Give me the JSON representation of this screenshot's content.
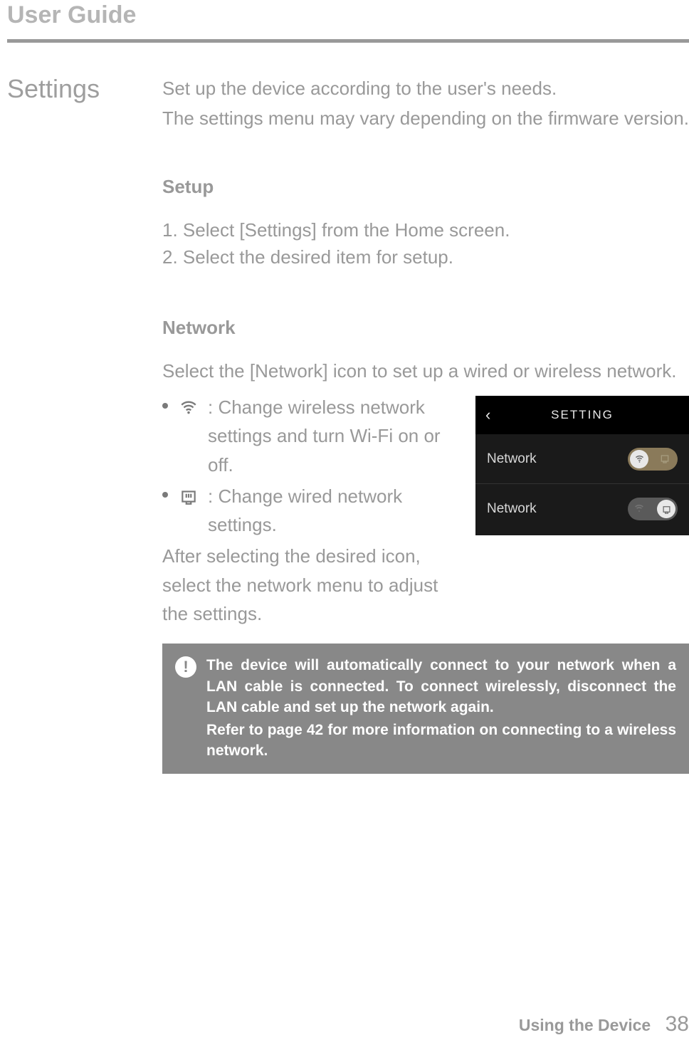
{
  "header": {
    "title": "User Guide"
  },
  "section": {
    "heading": "Settings",
    "intro1": "Set up the device according to the user's needs.",
    "intro2": "The settings menu may vary depending on the firmware version."
  },
  "setup": {
    "heading": "Setup",
    "step1": "1. Select [Settings] from the Home screen.",
    "step2": "2. Select the desired item for setup."
  },
  "network": {
    "heading": "Network",
    "intro": "Select the [Network] icon to set up a wired or wireless network.",
    "bullet1": ": Change wireless network settings and turn Wi-Fi on or off.",
    "bullet2": ": Change wired network settings.",
    "after": "After selecting the desired icon, select the network menu to adjust the settings."
  },
  "screenshot": {
    "title": "SETTING",
    "row1_label": "Network",
    "row2_label": "Network"
  },
  "callout": {
    "para1": "The device will automatically connect to your network when a LAN cable is connected. To connect wirelessly, disconnect the LAN cable and set up the network again.",
    "para2": "Refer to page 42 for more information on connecting to a wireless network."
  },
  "footer": {
    "label": "Using the Device",
    "page": "38"
  }
}
